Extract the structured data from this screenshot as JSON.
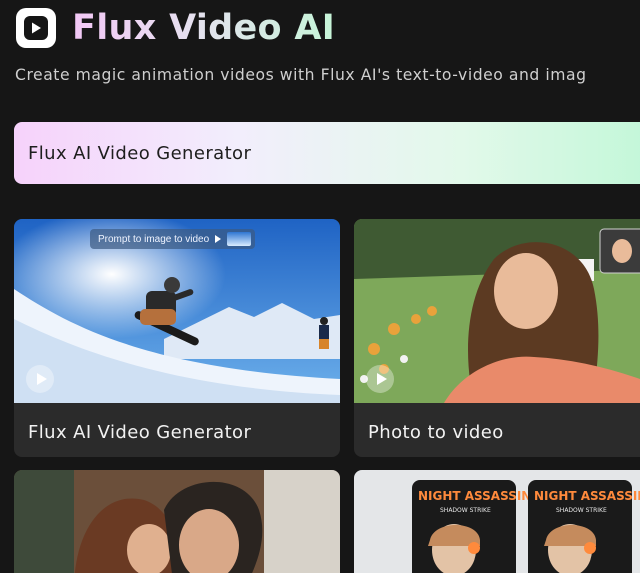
{
  "header": {
    "title": "Flux Video AI",
    "subtitle": "Create magic animation videos with Flux AI's text-to-video and imag"
  },
  "hero": {
    "label": "Flux AI Video Generator"
  },
  "cards": [
    {
      "caption": "Flux AI Video Generator",
      "chip_label": "Prompt to image to video"
    },
    {
      "caption": "Photo to video"
    },
    {
      "caption": ""
    },
    {
      "caption": "",
      "poster_title": "NIGHT ASSASSIN",
      "poster_subtitle": "SHADOW STRIKE"
    }
  ],
  "icons": {
    "logo": "play-logo-icon",
    "play": "play-icon",
    "chip_play": "play-triangle-icon"
  },
  "colors": {
    "background": "#161616",
    "card": "#2b2b2b",
    "gradient_start": "#f6d2fb",
    "gradient_end": "#c2f7d8"
  }
}
